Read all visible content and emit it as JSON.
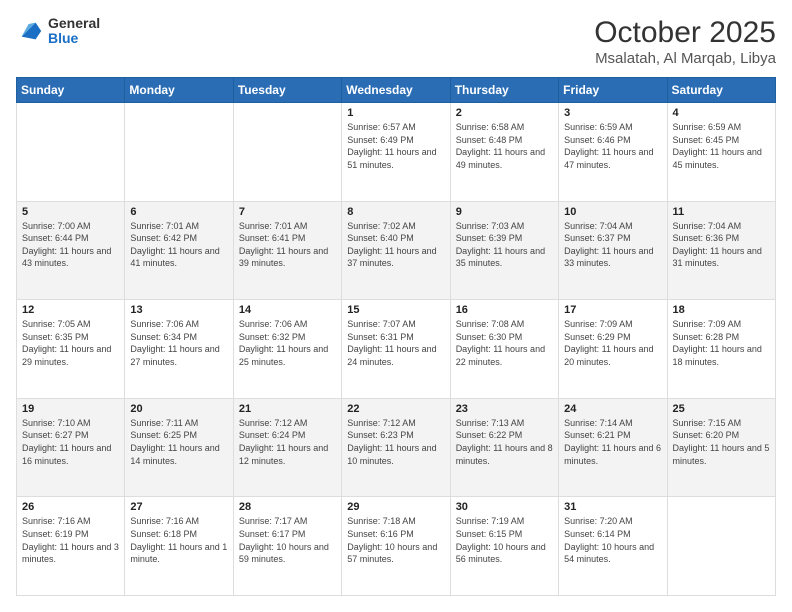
{
  "header": {
    "logo_general": "General",
    "logo_blue": "Blue",
    "month": "October 2025",
    "location": "Msalatah, Al Marqab, Libya"
  },
  "days_of_week": [
    "Sunday",
    "Monday",
    "Tuesday",
    "Wednesday",
    "Thursday",
    "Friday",
    "Saturday"
  ],
  "weeks": [
    [
      {
        "day": "",
        "info": ""
      },
      {
        "day": "",
        "info": ""
      },
      {
        "day": "",
        "info": ""
      },
      {
        "day": "1",
        "info": "Sunrise: 6:57 AM\nSunset: 6:49 PM\nDaylight: 11 hours and 51 minutes."
      },
      {
        "day": "2",
        "info": "Sunrise: 6:58 AM\nSunset: 6:48 PM\nDaylight: 11 hours and 49 minutes."
      },
      {
        "day": "3",
        "info": "Sunrise: 6:59 AM\nSunset: 6:46 PM\nDaylight: 11 hours and 47 minutes."
      },
      {
        "day": "4",
        "info": "Sunrise: 6:59 AM\nSunset: 6:45 PM\nDaylight: 11 hours and 45 minutes."
      }
    ],
    [
      {
        "day": "5",
        "info": "Sunrise: 7:00 AM\nSunset: 6:44 PM\nDaylight: 11 hours and 43 minutes."
      },
      {
        "day": "6",
        "info": "Sunrise: 7:01 AM\nSunset: 6:42 PM\nDaylight: 11 hours and 41 minutes."
      },
      {
        "day": "7",
        "info": "Sunrise: 7:01 AM\nSunset: 6:41 PM\nDaylight: 11 hours and 39 minutes."
      },
      {
        "day": "8",
        "info": "Sunrise: 7:02 AM\nSunset: 6:40 PM\nDaylight: 11 hours and 37 minutes."
      },
      {
        "day": "9",
        "info": "Sunrise: 7:03 AM\nSunset: 6:39 PM\nDaylight: 11 hours and 35 minutes."
      },
      {
        "day": "10",
        "info": "Sunrise: 7:04 AM\nSunset: 6:37 PM\nDaylight: 11 hours and 33 minutes."
      },
      {
        "day": "11",
        "info": "Sunrise: 7:04 AM\nSunset: 6:36 PM\nDaylight: 11 hours and 31 minutes."
      }
    ],
    [
      {
        "day": "12",
        "info": "Sunrise: 7:05 AM\nSunset: 6:35 PM\nDaylight: 11 hours and 29 minutes."
      },
      {
        "day": "13",
        "info": "Sunrise: 7:06 AM\nSunset: 6:34 PM\nDaylight: 11 hours and 27 minutes."
      },
      {
        "day": "14",
        "info": "Sunrise: 7:06 AM\nSunset: 6:32 PM\nDaylight: 11 hours and 25 minutes."
      },
      {
        "day": "15",
        "info": "Sunrise: 7:07 AM\nSunset: 6:31 PM\nDaylight: 11 hours and 24 minutes."
      },
      {
        "day": "16",
        "info": "Sunrise: 7:08 AM\nSunset: 6:30 PM\nDaylight: 11 hours and 22 minutes."
      },
      {
        "day": "17",
        "info": "Sunrise: 7:09 AM\nSunset: 6:29 PM\nDaylight: 11 hours and 20 minutes."
      },
      {
        "day": "18",
        "info": "Sunrise: 7:09 AM\nSunset: 6:28 PM\nDaylight: 11 hours and 18 minutes."
      }
    ],
    [
      {
        "day": "19",
        "info": "Sunrise: 7:10 AM\nSunset: 6:27 PM\nDaylight: 11 hours and 16 minutes."
      },
      {
        "day": "20",
        "info": "Sunrise: 7:11 AM\nSunset: 6:25 PM\nDaylight: 11 hours and 14 minutes."
      },
      {
        "day": "21",
        "info": "Sunrise: 7:12 AM\nSunset: 6:24 PM\nDaylight: 11 hours and 12 minutes."
      },
      {
        "day": "22",
        "info": "Sunrise: 7:12 AM\nSunset: 6:23 PM\nDaylight: 11 hours and 10 minutes."
      },
      {
        "day": "23",
        "info": "Sunrise: 7:13 AM\nSunset: 6:22 PM\nDaylight: 11 hours and 8 minutes."
      },
      {
        "day": "24",
        "info": "Sunrise: 7:14 AM\nSunset: 6:21 PM\nDaylight: 11 hours and 6 minutes."
      },
      {
        "day": "25",
        "info": "Sunrise: 7:15 AM\nSunset: 6:20 PM\nDaylight: 11 hours and 5 minutes."
      }
    ],
    [
      {
        "day": "26",
        "info": "Sunrise: 7:16 AM\nSunset: 6:19 PM\nDaylight: 11 hours and 3 minutes."
      },
      {
        "day": "27",
        "info": "Sunrise: 7:16 AM\nSunset: 6:18 PM\nDaylight: 11 hours and 1 minute."
      },
      {
        "day": "28",
        "info": "Sunrise: 7:17 AM\nSunset: 6:17 PM\nDaylight: 10 hours and 59 minutes."
      },
      {
        "day": "29",
        "info": "Sunrise: 7:18 AM\nSunset: 6:16 PM\nDaylight: 10 hours and 57 minutes."
      },
      {
        "day": "30",
        "info": "Sunrise: 7:19 AM\nSunset: 6:15 PM\nDaylight: 10 hours and 56 minutes."
      },
      {
        "day": "31",
        "info": "Sunrise: 7:20 AM\nSunset: 6:14 PM\nDaylight: 10 hours and 54 minutes."
      },
      {
        "day": "",
        "info": ""
      }
    ]
  ]
}
